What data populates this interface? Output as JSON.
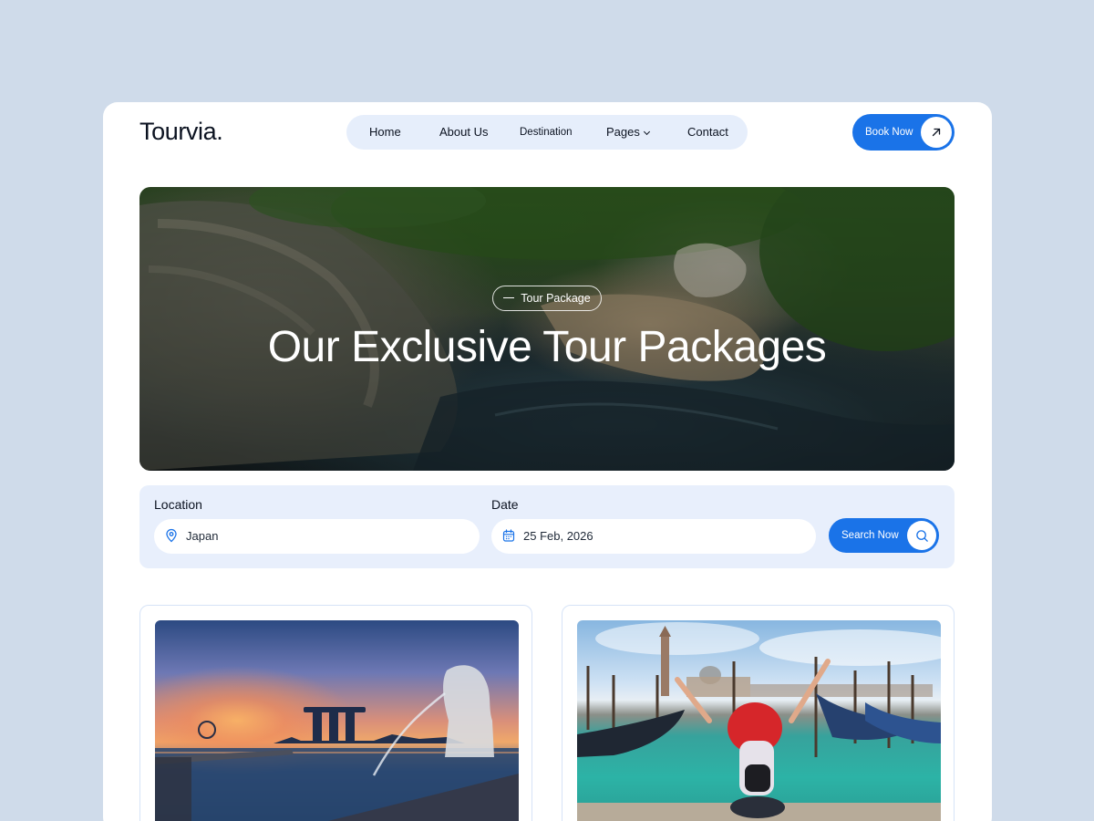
{
  "header": {
    "logo": "Tourvia.",
    "nav": [
      "Home",
      "About Us",
      "Destination",
      "Pages",
      "Contact"
    ],
    "book_label": "Book Now"
  },
  "hero": {
    "tag": "Tour Package",
    "title": "Our Exclusive Tour Packages"
  },
  "search": {
    "location_label": "Location",
    "location_value": "Japan",
    "date_label": "Date",
    "date_value": "25 Feb, 2026",
    "button_label": "Search Now"
  },
  "icons": {
    "logo_accent": "#1a73e8",
    "nav_pages_caret": "chevron-down-icon",
    "book": "arrow-up-right-icon",
    "location": "map-pin-icon",
    "date": "calendar-icon",
    "search": "search-icon"
  },
  "colors": {
    "page_bg": "#cfdbea",
    "accent": "#1a73e8",
    "panel_bg": "#e8effc",
    "nav_bg": "#e6eefb"
  }
}
